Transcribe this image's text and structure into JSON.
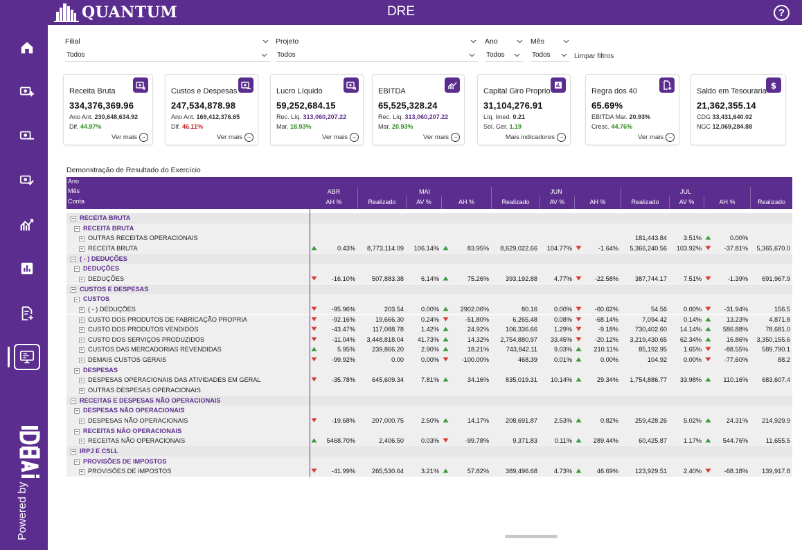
{
  "app": {
    "logo_text": "QUANTUM",
    "title": "DRE",
    "help": "?"
  },
  "sidebar": {
    "items": [
      {
        "icon": "home-icon"
      },
      {
        "icon": "cash-plus-icon"
      },
      {
        "icon": "cash-minus-icon"
      },
      {
        "icon": "cash-check-icon"
      },
      {
        "icon": "trend-chart-icon"
      },
      {
        "icon": "bar-chart-icon"
      },
      {
        "icon": "document-plus-icon"
      },
      {
        "icon": "monitor-report-icon"
      }
    ],
    "powered_by": "Powered by",
    "brand": "IDEA"
  },
  "filters": {
    "filial": {
      "label": "Filial",
      "value": "Todos"
    },
    "projeto": {
      "label": "Projeto",
      "value": "Todos"
    },
    "ano": {
      "label": "Ano",
      "value": "Todos"
    },
    "mes": {
      "label": "Mês",
      "value": "Todos"
    },
    "clear": "Limpar filtros"
  },
  "cards": [
    {
      "title": "Receita Bruta",
      "value": "334,376,369.96",
      "sub1_label": "Ano Ant.",
      "sub1_value": "230,648,634.92",
      "sub2_label": "Dif.",
      "sub2_value": "44.97%",
      "link": "Ver mais",
      "icon": "cash-plus-icon"
    },
    {
      "title": "Custos e Despesas",
      "value": "247,534,878.98",
      "sub1_label": "Ano Ant.",
      "sub1_value": "169,412,376.65",
      "sub2_label": "Dif.",
      "sub2_value": "46.11%",
      "link": "Ver mais",
      "icon": "cash-minus-icon"
    },
    {
      "title": "Lucro Líquido",
      "value": "59,252,684.15",
      "sub1_label": "Rec. Líq.",
      "sub1_value": "313,060,207.22",
      "sub2_label": "Mar.",
      "sub2_value": "18.93%",
      "link": "Ver mais",
      "icon": "cash-arrow-icon"
    },
    {
      "title": "EBITDA",
      "value": "65,525,328.24",
      "sub1_label": "Rec. Líq.",
      "sub1_value": "313,060,207.22",
      "sub2_label": "Mar.",
      "sub2_value": "20.93%",
      "link": "Ver mais",
      "icon": "trend-chart-icon"
    },
    {
      "title": "Capital Giro Proprio",
      "value": "31,104,276.91",
      "sub1_label": "Líq. Imed.",
      "sub1_value": "0.21",
      "sub2_label": "Sol. Ger.",
      "sub2_value": "1.19",
      "link": "Mais indicadores",
      "icon": "bar-chart-icon"
    },
    {
      "title": "Regra dos 40",
      "value": "65.69%",
      "sub1_label": "EBITDA Mar.",
      "sub1_value": "20.93%",
      "sub2_label": "Cresc.",
      "sub2_value": "44.76%",
      "link": "Ver mais",
      "icon": "document-plus-icon"
    },
    {
      "title": "Saldo em Tesouraria",
      "value": "21,362,355.14",
      "sub1_label": "CDG",
      "sub1_value": "33,431,640.02",
      "sub2_label": "NGC",
      "sub2_value": "12,069,284.88",
      "link": "",
      "icon": "dollar-icon"
    }
  ],
  "table": {
    "title": "Demonstração de Resultado do Exercício",
    "header_ano": "Ano",
    "header_mes": "Mês",
    "header_conta": "Conta",
    "months": [
      "ABR",
      "MAI",
      "JUN",
      "JUL"
    ],
    "columns": [
      "AH %",
      "Realizado",
      "AV %",
      "AH %",
      "Realizado",
      "AV %",
      "AH %",
      "Realizado",
      "AV %",
      "AH %",
      "Realizado"
    ],
    "rows": [
      {
        "level": 1,
        "label": "RECEITA BRUTA",
        "cells": []
      },
      {
        "level": 2,
        "label": "RECEITA BRUTA",
        "cells": []
      },
      {
        "level": 3,
        "label": "OUTRAS RECEITAS OPERACIONAIS",
        "cells": [
          "",
          "",
          "",
          "",
          "",
          "",
          "",
          "181,443.84",
          "3.51%",
          "0.00%",
          ""
        ],
        "arrows": [
          "",
          "",
          "",
          "",
          "",
          "",
          "",
          "",
          "",
          "up",
          ""
        ]
      },
      {
        "level": 3,
        "label": "RECEITA BRUTA",
        "cells": [
          "0.43%",
          "8,773,114.09",
          "106.14%",
          "83.95%",
          "8,629,022.66",
          "104.77%",
          "-1.64%",
          "5,366,240.56",
          "103.92%",
          "-37.81%",
          "5,365,670.0"
        ],
        "arrows": [
          "up",
          "",
          "",
          "up",
          "",
          "",
          "down",
          "",
          "",
          "down",
          ""
        ]
      },
      {
        "level": 1,
        "label": "( - ) DEDUÇÕES",
        "cells": []
      },
      {
        "level": 2,
        "label": "DEDUÇÕES",
        "cells": []
      },
      {
        "level": 3,
        "label": "DEDUÇÕES",
        "cells": [
          "-16.10%",
          "507,883.38",
          "6.14%",
          "75.26%",
          "393,192.88",
          "4.77%",
          "-22.58%",
          "387,744.17",
          "7.51%",
          "-1.39%",
          "691,967.9"
        ],
        "arrows": [
          "down",
          "",
          "",
          "up",
          "",
          "",
          "down",
          "",
          "",
          "down",
          ""
        ]
      },
      {
        "level": 1,
        "label": "CUSTOS E DESPESAS",
        "cells": []
      },
      {
        "level": 2,
        "label": "CUSTOS",
        "cells": []
      },
      {
        "level": 3,
        "label": "( - ) DEDUÇÕES",
        "cells": [
          "-95.96%",
          "203.54",
          "0.00%",
          "2902.06%",
          "80.16",
          "0.00%",
          "-60.62%",
          "54.56",
          "0.00%",
          "-31.94%",
          "156.5"
        ],
        "arrows": [
          "down",
          "",
          "",
          "up",
          "",
          "",
          "down",
          "",
          "",
          "down",
          ""
        ]
      },
      {
        "level": 3,
        "label": "CUSTO DOS PRODUTOS DE FABRICAÇÃO PROPRIA",
        "cells": [
          "-92.16%",
          "19,666.30",
          "0.24%",
          "-51.80%",
          "6,265.48",
          "0.08%",
          "-68.14%",
          "7,094.42",
          "0.14%",
          "13.23%",
          "4,871.8"
        ],
        "arrows": [
          "down",
          "",
          "",
          "down",
          "",
          "",
          "down",
          "",
          "",
          "up",
          ""
        ]
      },
      {
        "level": 3,
        "label": "CUSTO DOS PRODUTOS VENDIDOS",
        "cells": [
          "-43.47%",
          "117,088.78",
          "1.42%",
          "24.92%",
          "106,336.66",
          "1.29%",
          "-9.18%",
          "730,402.60",
          "14.14%",
          "586.88%",
          "78,681.0"
        ],
        "arrows": [
          "down",
          "",
          "",
          "up",
          "",
          "",
          "down",
          "",
          "",
          "up",
          ""
        ]
      },
      {
        "level": 3,
        "label": "CUSTO DOS SERVIÇOS PRODUZIDOS",
        "cells": [
          "-11.04%",
          "3,448,818.04",
          "41.73%",
          "14.32%",
          "2,754,880.97",
          "33.45%",
          "-20.12%",
          "3,219,430.65",
          "62.34%",
          "16.86%",
          "3,350,155.6"
        ],
        "arrows": [
          "down",
          "",
          "",
          "up",
          "",
          "",
          "down",
          "",
          "",
          "up",
          ""
        ]
      },
      {
        "level": 3,
        "label": "CUSTOS DAS MERCADORIAS REVENDIDAS",
        "cells": [
          "5.95%",
          "239,866.20",
          "2.90%",
          "18.21%",
          "743,842.11",
          "9.03%",
          "210.11%",
          "85,192.95",
          "1.65%",
          "-88.55%",
          "589,790.1"
        ],
        "arrows": [
          "up",
          "",
          "",
          "up",
          "",
          "",
          "up",
          "",
          "",
          "down",
          ""
        ]
      },
      {
        "level": 3,
        "label": "DEMAIS CUSTOS GERAIS",
        "cells": [
          "-99.92%",
          "0.00",
          "0.00%",
          "-100.00%",
          "468.39",
          "0.01%",
          "0.00%",
          "104.92",
          "0.00%",
          "-77.60%",
          "88.2"
        ],
        "arrows": [
          "down",
          "",
          "",
          "down",
          "",
          "",
          "up",
          "",
          "",
          "down",
          ""
        ]
      },
      {
        "level": 2,
        "label": "DESPESAS",
        "cells": []
      },
      {
        "level": 3,
        "label": "DESPESAS OPERACIONAIS DAS ATIVIDADES EM GERAL",
        "cells": [
          "-35.78%",
          "645,609.34",
          "7.81%",
          "34.16%",
          "835,019.31",
          "10.14%",
          "29.34%",
          "1,754,886.77",
          "33.98%",
          "110.16%",
          "683,607.4"
        ],
        "arrows": [
          "down",
          "",
          "",
          "up",
          "",
          "",
          "up",
          "",
          "",
          "up",
          ""
        ]
      },
      {
        "level": 3,
        "label": "OUTRAS DESPESAS OPERACIONAIS",
        "cells": [
          "",
          "",
          "",
          "",
          "",
          "",
          "",
          "",
          "",
          "",
          ""
        ],
        "arrows": []
      },
      {
        "level": 1,
        "label": "RECEITAS E DESPESAS NÃO OPERACIONAIS",
        "cells": []
      },
      {
        "level": 2,
        "label": "DESPESAS NÃO OPERACIONAIS",
        "cells": []
      },
      {
        "level": 3,
        "label": "DESPESAS NÃO OPERACIONAIS",
        "cells": [
          "-19.68%",
          "207,000.75",
          "2.50%",
          "14.17%",
          "208,691.87",
          "2.53%",
          "0.82%",
          "259,428.26",
          "5.02%",
          "24.31%",
          "214,929.9"
        ],
        "arrows": [
          "down",
          "",
          "",
          "up",
          "",
          "",
          "up",
          "",
          "",
          "up",
          ""
        ]
      },
      {
        "level": 2,
        "label": "RECEITAS NÃO OPERACIONAIS",
        "cells": []
      },
      {
        "level": 3,
        "label": "RECEITAS NÃO OPERACIONAIS",
        "cells": [
          "5468.70%",
          "2,406.50",
          "0.03%",
          "-99.78%",
          "9,371.83",
          "0.11%",
          "289.44%",
          "60,425.87",
          "1.17%",
          "544.76%",
          "11,655.5"
        ],
        "arrows": [
          "up",
          "",
          "",
          "down",
          "",
          "",
          "up",
          "",
          "",
          "up",
          ""
        ]
      },
      {
        "level": 1,
        "label": "IRPJ E CSLL",
        "cells": []
      },
      {
        "level": 2,
        "label": "PROVISÕES DE IMPOSTOS",
        "cells": []
      },
      {
        "level": 3,
        "label": "PROVISÕES DE IMPOSTOS",
        "cells": [
          "-41.99%",
          "265,530.64",
          "3.21%",
          "57.82%",
          "389,496.68",
          "4.73%",
          "46.69%",
          "123,929.51",
          "2.40%",
          "-68.18%",
          "139,917.8"
        ],
        "arrows": [
          "down",
          "",
          "",
          "up",
          "",
          "",
          "up",
          "",
          "",
          "down",
          ""
        ]
      }
    ]
  },
  "colors": {
    "brand": "#5b2d8e",
    "positive": "#2e8b1e",
    "negative": "#c0262c",
    "arrow_up": "#3a9a3a",
    "arrow_down": "#d93a2f"
  }
}
